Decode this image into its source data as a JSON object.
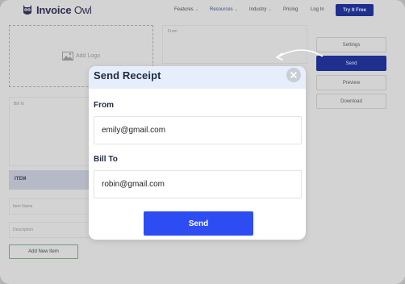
{
  "nav": {
    "brand_bold": "Invoice",
    "brand_light": " Owl",
    "menu": [
      {
        "label": "Features",
        "caret": "⌄"
      },
      {
        "label": "Resources",
        "caret": "⌄"
      },
      {
        "label": "Industry",
        "caret": "⌄"
      },
      {
        "label": "Pricing"
      },
      {
        "label": "Log In"
      }
    ],
    "cta": "Try It Free"
  },
  "form": {
    "add_logo": "Add Logo",
    "from_label": "From",
    "bill_to_label": "Bill To",
    "item_header": "ITEM",
    "item_name_placeholder": "Item Name",
    "description_placeholder": "Description",
    "add_new_item": "Add New Item"
  },
  "sidebar": {
    "buttons": [
      "Settings",
      "Send",
      "Preview",
      "Download"
    ]
  },
  "modal": {
    "title": "Send Receipt",
    "from_label": "From",
    "from_value": "emily@gmail.com",
    "bill_to_label": "Bill To",
    "bill_to_value": "robin@gmail.com",
    "send_label": "Send"
  },
  "colors": {
    "primary": "#2d4df3",
    "nav_button": "#1e2f8e",
    "modal_header": "#e6eefb"
  }
}
